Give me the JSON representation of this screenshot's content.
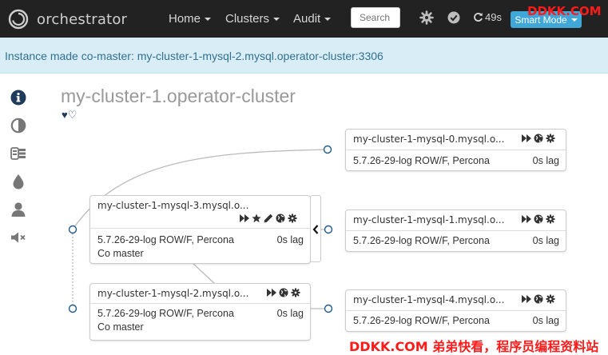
{
  "navbar": {
    "brand": "orchestrator",
    "menu": [
      {
        "label": "Home"
      },
      {
        "label": "Clusters"
      },
      {
        "label": "Audit"
      }
    ],
    "search_placeholder": "Search",
    "refresh_countdown": "49s",
    "smart_mode_label": "Smart Mode",
    "watermark": "DDKK.COM"
  },
  "alert": {
    "message": "Instance made co-master: my-cluster-1-mysql-2.mysql.operator-cluster:3306"
  },
  "sidebar": {
    "items": [
      {
        "icon": "info-icon"
      },
      {
        "icon": "contrast-icon"
      },
      {
        "icon": "database-icon"
      },
      {
        "icon": "drop-icon"
      },
      {
        "icon": "user-icon"
      },
      {
        "icon": "mute-icon"
      }
    ]
  },
  "cluster": {
    "title": "my-cluster-1.operator-cluster",
    "hearts": "♥♡"
  },
  "nodes": [
    {
      "name": "my-cluster-1-mysql-0.mysql.o...",
      "version": "5.7.26-29-log ROW/F, Percona",
      "lag": "0s lag"
    },
    {
      "name": "my-cluster-1-mysql-3.mysql.o...",
      "version": "5.7.26-29-log ROW/F, Percona",
      "lag": "0s lag",
      "role": "Co master"
    },
    {
      "name": "my-cluster-1-mysql-1.mysql.o...",
      "version": "5.7.26-29-log ROW/F, Percona",
      "lag": "0s lag"
    },
    {
      "name": "my-cluster-1-mysql-2.mysql.o...",
      "version": "5.7.26-29-log ROW/F, Percona",
      "lag": "0s lag",
      "role": "Co master"
    },
    {
      "name": "my-cluster-1-mysql-4.mysql.o...",
      "version": "5.7.26-29-log ROW/F, Percona",
      "lag": "0s lag"
    }
  ],
  "footer_watermark": "DDKK.COM 弟弟快看，程序员编程资料站",
  "colors": {
    "navbar_bg": "#222222",
    "alert_bg": "#d9edf7",
    "alert_text": "#31708f",
    "accent": "#3fa8d8",
    "connector": "#1f5a8a"
  }
}
